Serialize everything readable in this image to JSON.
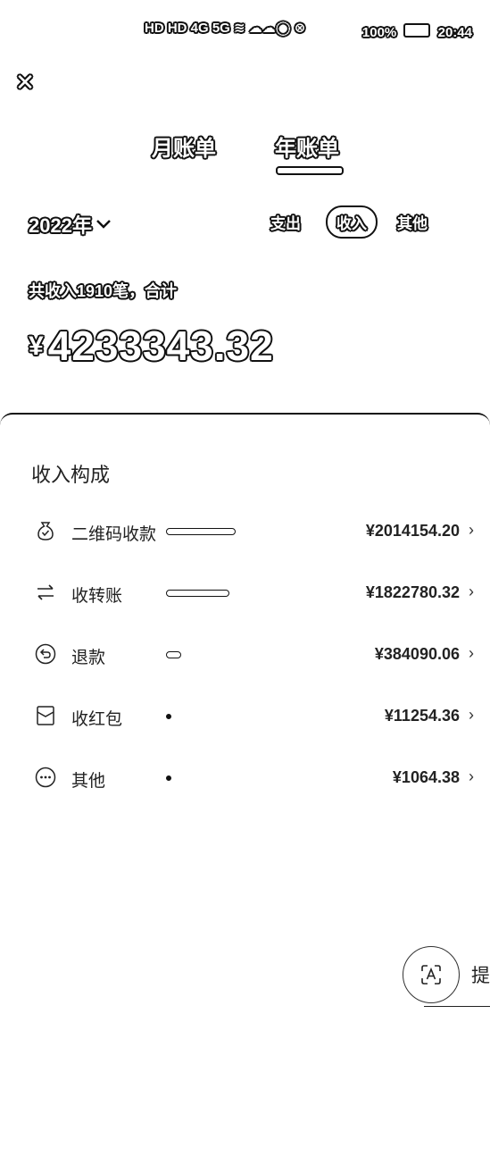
{
  "status_bar": {
    "icons_text": "HD HD 4G 5G  ≋ ☁☁◯ ⊗",
    "battery": "100%",
    "time": "20:44"
  },
  "tabs": [
    {
      "label": "月账单",
      "active": false
    },
    {
      "label": "年账单",
      "active": true
    }
  ],
  "year_select": {
    "value": "2022年"
  },
  "filters": [
    {
      "label": "支出",
      "active": false
    },
    {
      "label": "收入",
      "active": true
    },
    {
      "label": "其他",
      "active": false
    }
  ],
  "summary": {
    "count_text": "共收入1910笔，合计",
    "currency": "¥",
    "total": "4233343.32"
  },
  "composition": {
    "title": "收入构成",
    "rows": [
      {
        "icon": "money-bag-icon",
        "label": "二维码收款",
        "amount": "¥2014154.20",
        "share": 0.476
      },
      {
        "icon": "transfer-icon",
        "label": "收转账",
        "amount": "¥1822780.32",
        "share": 0.431
      },
      {
        "icon": "refund-icon",
        "label": "退款",
        "amount": "¥384090.06",
        "share": 0.091
      },
      {
        "icon": "red-packet-icon",
        "label": "收红包",
        "amount": "¥11254.36",
        "share": 0.003
      },
      {
        "icon": "more-icon",
        "label": "其他",
        "amount": "¥1064.38",
        "share": 0.0003
      }
    ]
  },
  "fab": {
    "icon": "scan-text-icon",
    "label": "提"
  }
}
